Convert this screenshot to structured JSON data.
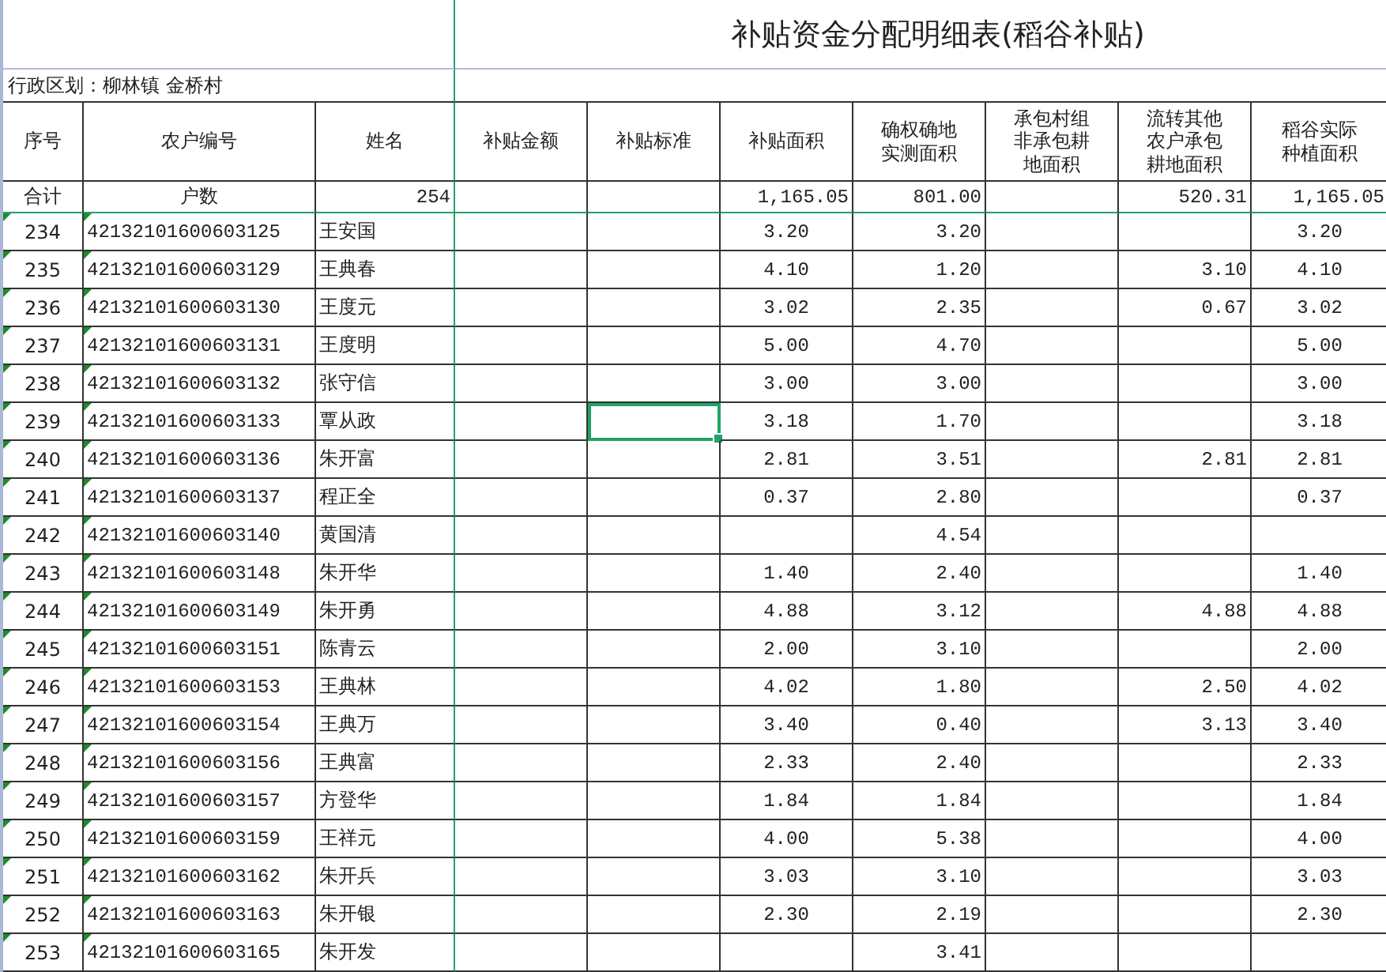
{
  "title": "补贴资金分配明细表(稻谷补贴)",
  "region": "行政区划：柳林镇 金桥村",
  "columns": [
    "序号",
    "农户编号",
    "姓名",
    "补贴金额",
    "补贴标准",
    "补贴面积",
    "确权确地实测面积",
    "承包村组非承包耕地面积",
    "流转其他农户承包耕地面积",
    "稻谷实际种植面积"
  ],
  "totals": {
    "no": "合计",
    "farmer_id": "户数",
    "name": "254",
    "subsidy_area": "1,165.05",
    "measured_area": "801.00",
    "transferred_area": "520.31",
    "planted_area": "1,165.05"
  },
  "rows": [
    {
      "no": "234",
      "farmer_id": "42132101600603125",
      "name": "王安国",
      "subsidy_area": "3.20",
      "measured_area": "3.20",
      "planted_area": "3.20",
      "flagged": true
    },
    {
      "no": "235",
      "farmer_id": "42132101600603129",
      "name": "王典春",
      "subsidy_area": "4.10",
      "measured_area": "1.20",
      "transferred_area": "3.10",
      "planted_area": "4.10",
      "flagged": true
    },
    {
      "no": "236",
      "farmer_id": "42132101600603130",
      "name": "王度元",
      "subsidy_area": "3.02",
      "measured_area": "2.35",
      "transferred_area": "0.67",
      "planted_area": "3.02",
      "flagged": true
    },
    {
      "no": "237",
      "farmer_id": "42132101600603131",
      "name": "王度明",
      "subsidy_area": "5.00",
      "measured_area": "4.70",
      "planted_area": "5.00",
      "flagged": true
    },
    {
      "no": "238",
      "farmer_id": "42132101600603132",
      "name": "张守信",
      "subsidy_area": "3.00",
      "measured_area": "3.00",
      "planted_area": "3.00",
      "flagged": true
    },
    {
      "no": "239",
      "farmer_id": "42132101600603133",
      "name": "覃从政",
      "subsidy_area": "3.18",
      "measured_area": "1.70",
      "planted_area": "3.18",
      "flagged": true,
      "subsidy_standard": {
        "selected": true
      }
    },
    {
      "no": "240",
      "farmer_id": "42132101600603136",
      "name": "朱开富",
      "subsidy_area": "2.81",
      "measured_area": "3.51",
      "transferred_area": "2.81",
      "planted_area": "2.81",
      "flagged": true
    },
    {
      "no": "241",
      "farmer_id": "42132101600603137",
      "name": "程正全",
      "subsidy_area": "0.37",
      "measured_area": "2.80",
      "planted_area": "0.37",
      "flagged": true
    },
    {
      "no": "242",
      "farmer_id": "42132101600603140",
      "name": "黄国清",
      "measured_area": "4.54",
      "flagged": true
    },
    {
      "no": "243",
      "farmer_id": "42132101600603148",
      "name": "朱开华",
      "subsidy_area": "1.40",
      "measured_area": "2.40",
      "planted_area": "1.40",
      "flagged": true
    },
    {
      "no": "244",
      "farmer_id": "42132101600603149",
      "name": "朱开勇",
      "subsidy_area": "4.88",
      "measured_area": "3.12",
      "transferred_area": "4.88",
      "planted_area": "4.88",
      "flagged": true
    },
    {
      "no": "245",
      "farmer_id": "42132101600603151",
      "name": "陈青云",
      "subsidy_area": "2.00",
      "measured_area": "3.10",
      "planted_area": "2.00",
      "flagged": true
    },
    {
      "no": "246",
      "farmer_id": "42132101600603153",
      "name": "王典林",
      "subsidy_area": "4.02",
      "measured_area": "1.80",
      "transferred_area": "2.50",
      "planted_area": "4.02",
      "flagged": true
    },
    {
      "no": "247",
      "farmer_id": "42132101600603154",
      "name": "王典万",
      "subsidy_area": "3.40",
      "measured_area": "0.40",
      "transferred_area": "3.13",
      "planted_area": "3.40",
      "flagged": true
    },
    {
      "no": "248",
      "farmer_id": "42132101600603156",
      "name": "王典富",
      "subsidy_area": "2.33",
      "measured_area": "2.40",
      "planted_area": "2.33",
      "flagged": true
    },
    {
      "no": "249",
      "farmer_id": "42132101600603157",
      "name": "方登华",
      "subsidy_area": "1.84",
      "measured_area": "1.84",
      "planted_area": "1.84",
      "flagged": true
    },
    {
      "no": "250",
      "farmer_id": "42132101600603159",
      "name": "王祥元",
      "subsidy_area": "4.00",
      "measured_area": "5.38",
      "planted_area": "4.00",
      "flagged": true
    },
    {
      "no": "251",
      "farmer_id": "42132101600603162",
      "name": "朱开兵",
      "subsidy_area": "3.03",
      "measured_area": "3.10",
      "planted_area": "3.03",
      "flagged": true
    },
    {
      "no": "252",
      "farmer_id": "42132101600603163",
      "name": "朱开银",
      "subsidy_area": "2.30",
      "measured_area": "2.19",
      "planted_area": "2.30",
      "flagged": true
    },
    {
      "no": "253",
      "farmer_id": "42132101600603165",
      "name": "朱开发",
      "measured_area": "3.41",
      "flagged": true
    }
  ]
}
